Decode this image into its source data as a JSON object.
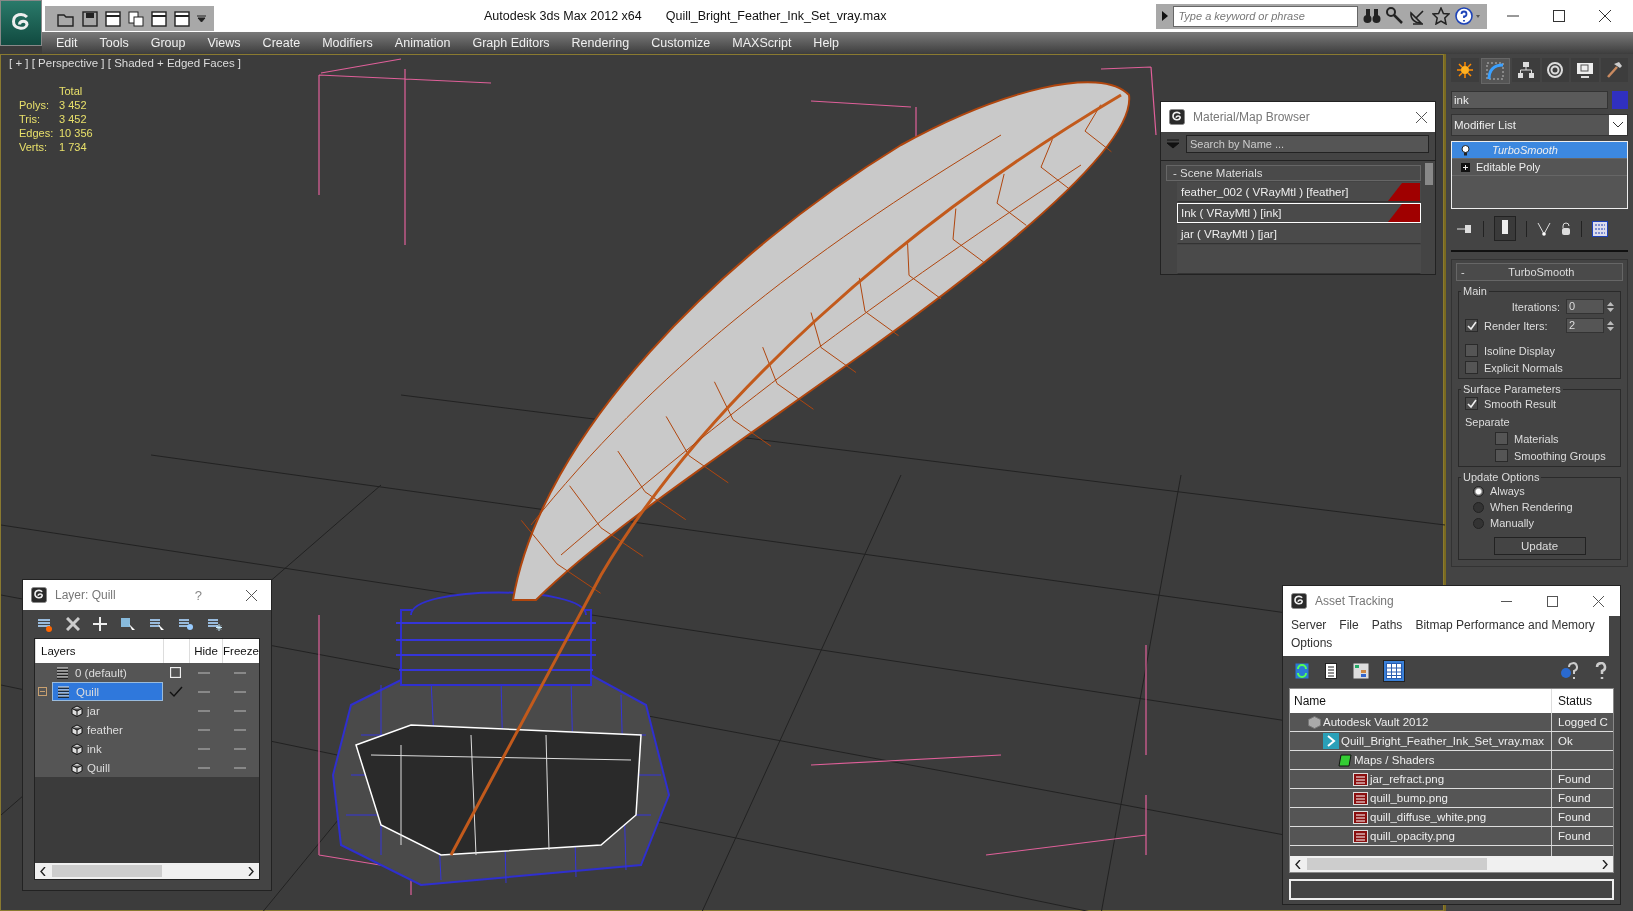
{
  "window": {
    "app_title": "Autodesk 3ds Max  2012 x64",
    "file_title": "Quill_Bright_Feather_Ink_Set_vray.max"
  },
  "help_search": {
    "placeholder": "Type a keyword or phrase"
  },
  "menu": [
    "Edit",
    "Tools",
    "Group",
    "Views",
    "Create",
    "Modifiers",
    "Animation",
    "Graph Editors",
    "Rendering",
    "Customize",
    "MAXScript",
    "Help"
  ],
  "viewport": {
    "label": "[ + ] [ Perspective ] [ Shaded + Edged Faces ]",
    "stats_header": "Total",
    "stats": [
      {
        "label": "Polys:",
        "value": "3 452"
      },
      {
        "label": "Tris:",
        "value": "3 452"
      },
      {
        "label": "Edges:",
        "value": "10 356"
      },
      {
        "label": "Verts:",
        "value": "1 734"
      }
    ]
  },
  "material_browser": {
    "title": "Material/Map Browser",
    "search_placeholder": "Search by Name ...",
    "group": "-  Scene Materials",
    "materials": [
      {
        "name": "feather_002  ( VRayMtl ) [feather]",
        "selected": false,
        "assigned": true
      },
      {
        "name": "Ink  ( VRayMtl ) [ink]",
        "selected": true,
        "assigned": true
      },
      {
        "name": "jar  ( VRayMtl ) [jar]",
        "selected": false,
        "assigned": false
      }
    ]
  },
  "command_panel": {
    "tabs": [
      {
        "kind": "create",
        "selected": false
      },
      {
        "kind": "modify",
        "selected": true
      },
      {
        "kind": "hierarchy",
        "selected": false
      },
      {
        "kind": "motion",
        "selected": false
      },
      {
        "kind": "display",
        "selected": false
      },
      {
        "kind": "utilities",
        "selected": false
      }
    ],
    "object": {
      "name": "ink",
      "color": "#3030c0"
    },
    "modifier_list": "Modifier List",
    "stack": [
      {
        "name": "TurboSmooth",
        "kind": "modifier",
        "selected": true
      },
      {
        "name": "Editable Poly",
        "kind": "base",
        "selected": false,
        "expanded": false
      }
    ],
    "rollout": {
      "toggle": "-",
      "title": "TurboSmooth",
      "main_group": "Main",
      "iterations_label": "Iterations:",
      "iterations": "0",
      "render_iters_label": "Render Iters:",
      "render_iters_checked": true,
      "render_iters": "2",
      "options": [
        {
          "label": "Isoline Display",
          "checked": false
        },
        {
          "label": "Explicit Normals",
          "checked": false
        }
      ],
      "surface_group": "Surface Parameters",
      "smooth_result": {
        "label": "Smooth Result",
        "checked": true
      },
      "separate_label": "Separate",
      "separate": [
        {
          "label": "Materials",
          "checked": false
        },
        {
          "label": "Smoothing Groups",
          "checked": false
        }
      ],
      "update_group": "Update Options",
      "update_modes": [
        {
          "label": "Always",
          "selected": true
        },
        {
          "label": "When Rendering",
          "selected": false
        },
        {
          "label": "Manually",
          "selected": false
        }
      ],
      "update_button": "Update"
    }
  },
  "layer_window": {
    "title": "Layer: Quill",
    "help": "?",
    "columns": [
      "Layers",
      "Hide",
      "Freeze"
    ],
    "layers": [
      {
        "name": "0 (default)",
        "kind": "layer",
        "current": false,
        "selected": false
      },
      {
        "name": "Quill",
        "kind": "layer",
        "current": true,
        "selected": true,
        "expanded": true,
        "children": [
          {
            "name": "jar",
            "kind": "object"
          },
          {
            "name": "feather",
            "kind": "object"
          },
          {
            "name": "ink",
            "kind": "object"
          },
          {
            "name": "Quill",
            "kind": "object"
          }
        ]
      }
    ]
  },
  "asset_tracking": {
    "title": "Asset Tracking",
    "menu": [
      "Server",
      "File",
      "Paths",
      "Bitmap Performance and Memory",
      "Options"
    ],
    "toolbar": [
      {
        "kind": "refresh",
        "selected": false
      },
      {
        "kind": "list",
        "selected": false
      },
      {
        "kind": "tree",
        "selected": false
      },
      {
        "kind": "table",
        "selected": true
      }
    ],
    "columns": [
      "Name",
      "Status"
    ],
    "rows": [
      {
        "name": "Autodesk Vault 2012",
        "status": "Logged C",
        "kind": "vault",
        "children": [
          {
            "name": "Quill_Bright_Feather_Ink_Set_vray.max",
            "status": "Ok",
            "kind": "max-file",
            "children": [
              {
                "name": "Maps / Shaders",
                "kind": "folder",
                "children": [
                  {
                    "name": "jar_refract.png",
                    "status": "Found",
                    "kind": "png"
                  },
                  {
                    "name": "quill_bump.png",
                    "status": "Found",
                    "kind": "png"
                  },
                  {
                    "name": "quill_diffuse_white.png",
                    "status": "Found",
                    "kind": "png"
                  },
                  {
                    "name": "quill_opacity.png",
                    "status": "Found",
                    "kind": "png"
                  }
                ]
              }
            ]
          }
        ]
      }
    ]
  }
}
